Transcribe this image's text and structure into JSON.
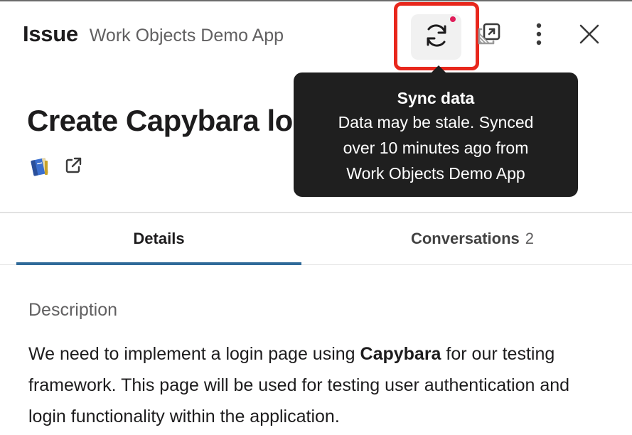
{
  "header": {
    "kind": "Issue",
    "app_name": "Work Objects Demo App"
  },
  "toolbar": {
    "sync_icon": "sync-icon",
    "popout_icon": "open-in-new-window-icon",
    "more_icon": "more-vertical-icon",
    "close_icon": "close-icon",
    "highlight_color": "#e8271c",
    "notification_dot_color": "#e01e5a"
  },
  "tooltip": {
    "title": "Sync data",
    "line1": "Data may be stale. Synced",
    "line2": "over 10 minutes ago from",
    "line3": "Work Objects Demo App"
  },
  "item": {
    "title": "Create Capybara lo",
    "app_icon": "book-icon",
    "link_icon": "external-link-icon"
  },
  "tabs": [
    {
      "label": "Details",
      "active": true
    },
    {
      "label": "Conversations",
      "count": "2",
      "active": false
    }
  ],
  "description": {
    "label": "Description",
    "text_before": "We need to implement a login page using ",
    "text_bold": "Capybara",
    "text_after": " for our testing framework. This page will be used for testing user authentication and login functionality within the application."
  },
  "colors": {
    "tab_active_underline": "#2f6a99",
    "tooltip_bg": "#1f1f1f"
  }
}
